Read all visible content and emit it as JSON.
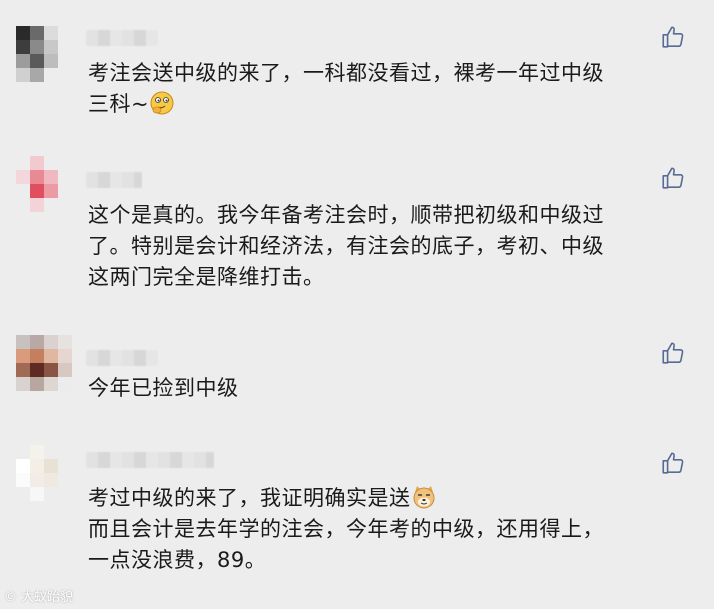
{
  "comments": [
    {
      "lines": [
        "考注会送中级的来了，一科都没看过，裸考一年过中级",
        "三科~"
      ],
      "emoji": "thinking-face-emoji",
      "avatar_colors": [
        "#2a2a2a",
        "#6a6a6a",
        "#dcdcdc",
        "#ededed",
        "#3d3d3d",
        "#8a8a8a",
        "#c8c8c8",
        "#ededed",
        "#9c9c9c",
        "#5a5a5a",
        "#bdbdbd",
        "#ededed",
        "#d0d0d0",
        "#a8a8a8",
        "#ededed",
        "#ededed"
      ]
    },
    {
      "lines": [
        "这个是真的。我今年备考注会时，顺带把初级和中级过",
        "了。特别是会计和经济法，有注会的底子，考初、中级",
        "这两门完全是降维打击。"
      ],
      "avatar_colors": [
        "#ededed",
        "#f2c9cf",
        "#ededed",
        "#ededed",
        "#f4d7dc",
        "#e88a94",
        "#f0b8c0",
        "#ededed",
        "#ededed",
        "#e04f60",
        "#ec9aa4",
        "#ededed",
        "#ededed",
        "#f3d3d8",
        "#ededed",
        "#ededed"
      ]
    },
    {
      "lines": [
        "今年已捡到中级"
      ],
      "avatar_colors": [
        "#c9c1bf",
        "#b9a9a6",
        "#d9d2d0",
        "#e6e2e0",
        "#d99b7d",
        "#c47f5f",
        "#e0b8a2",
        "#e6d6cf",
        "#a06a55",
        "#5e2a22",
        "#8a5545",
        "#d8c8c2",
        "#d8d2d0",
        "#b8a6a0",
        "#ddd6d3",
        "#ececec"
      ]
    },
    {
      "lines": [
        "考过中级的来了，我证明确实是送",
        "而且会计是去年学的注会，今年考的中级，还用得上，",
        "一点没浪费，89。"
      ],
      "emoji": "doge-emoji",
      "avatar_colors": [
        "#ededed",
        "#f5f2ec",
        "#ededed",
        "#ededed",
        "#ffffff",
        "#f3efe6",
        "#e8e2d4",
        "#ededed",
        "#fbfbfb",
        "#f1ede6",
        "#efeae0",
        "#ededed",
        "#ededed",
        "#f7f7f7",
        "#ededed",
        "#ededed"
      ]
    }
  ],
  "like_icon": "thumbs-up-outline-icon",
  "watermark": "大蚊跆貌",
  "colors": {
    "background": "#ededed",
    "text": "#1a1a1a",
    "icon": "#586b95"
  }
}
